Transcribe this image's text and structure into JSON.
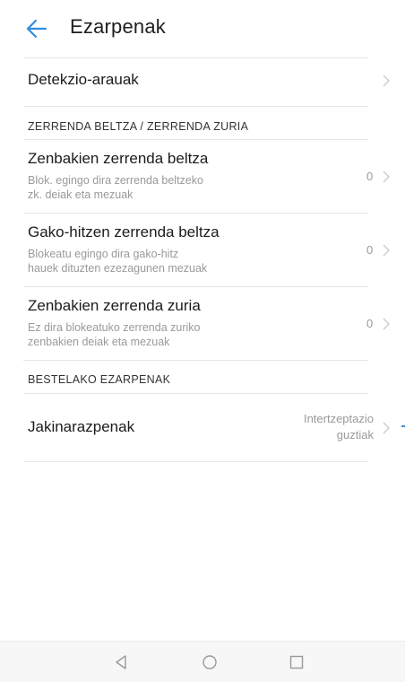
{
  "header": {
    "title": "Ezarpenak",
    "back_icon": "arrow-left-icon",
    "accent_color": "#2f8ee0"
  },
  "rows": {
    "detection_rules": {
      "title": "Detekzio-arauak"
    },
    "blacklist_numbers": {
      "title": "Zenbakien zerrenda beltza",
      "desc_line1": "Blok. egingo dira zerrenda beltzeko",
      "desc_line2": "zk. deiak eta mezuak",
      "value": "0"
    },
    "keyword_blacklist": {
      "title": "Gako-hitzen zerrenda beltza",
      "desc_line1": "Blokeatu egingo dira gako-hitz",
      "desc_line2": "hauek dituzten ezezagunen mezuak",
      "value": "0"
    },
    "whitelist_numbers": {
      "title": "Zenbakien zerrenda zuria",
      "desc_line1": "Ez dira blokeatuko zerrenda zuriko",
      "desc_line2": "zenbakien deiak eta mezuak",
      "value": "0"
    },
    "notifications": {
      "title": "Jakinarazpenak",
      "value_line1": "Intertzeptazio",
      "value_line2": "guztiak"
    }
  },
  "sections": {
    "lists": "ZERRENDA BELTZA / ZERRENDA ZURIA",
    "other": "BESTELAKO EZARPENAK"
  },
  "navbar": {
    "back_icon": "triangle-back-icon",
    "home_icon": "circle-home-icon",
    "recents_icon": "square-recents-icon"
  }
}
